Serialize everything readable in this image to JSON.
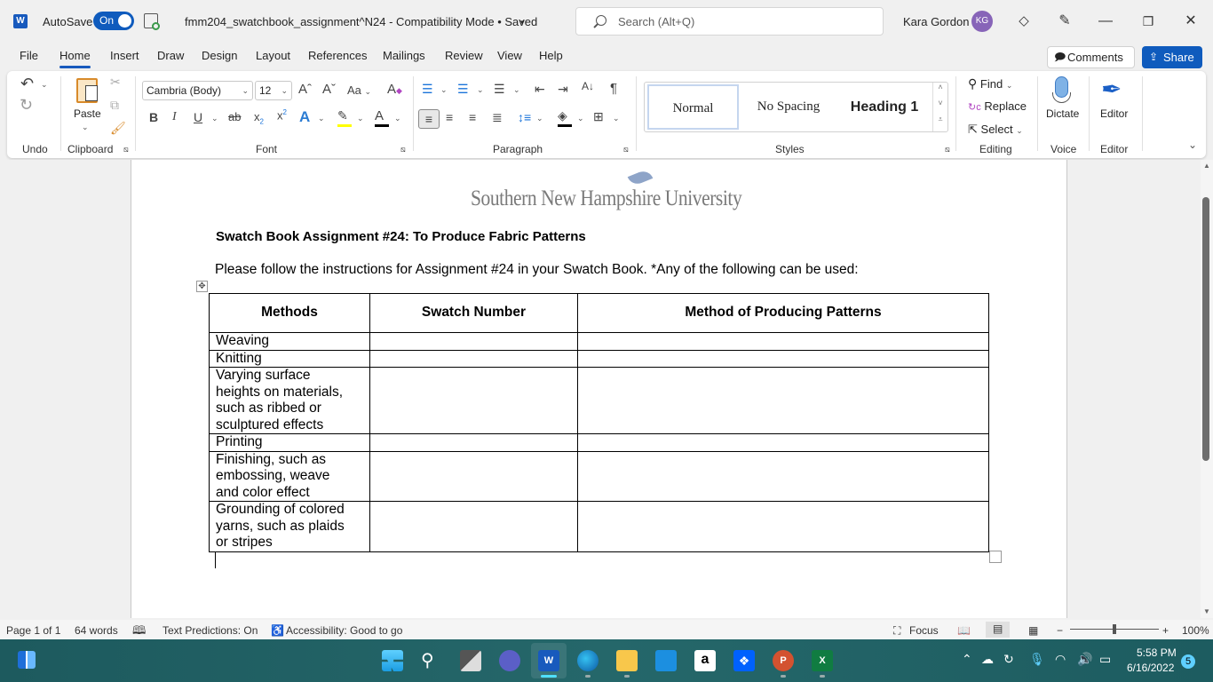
{
  "titlebar": {
    "app_icon": "word-logo-icon",
    "autosave_label": "AutoSave",
    "autosave_state": "On",
    "document_title": "fmm204_swatchbook_assignment^N24  -  Compatibility Mode • Saved",
    "search_placeholder": "Search (Alt+Q)",
    "user_name": "Kara Gordon",
    "user_initials": "KG"
  },
  "menu": {
    "tabs": [
      "File",
      "Home",
      "Insert",
      "Draw",
      "Design",
      "Layout",
      "References",
      "Mailings",
      "Review",
      "View",
      "Help"
    ],
    "active_tab": "Home",
    "comments_label": "Comments",
    "share_label": "Share"
  },
  "ribbon": {
    "groups": [
      "Undo",
      "Clipboard",
      "Font",
      "Paragraph",
      "Styles",
      "Editing",
      "Voice",
      "Editor"
    ],
    "paste_label": "Paste",
    "font_name": "Cambria (Body)",
    "font_size": "12",
    "change_case_label": "Aa",
    "styles": [
      "Normal",
      "No Spacing",
      "Heading 1"
    ],
    "selected_style": "Normal",
    "find_label": "Find",
    "replace_label": "Replace",
    "select_label": "Select",
    "dictate_label": "Dictate",
    "editor_label": "Editor",
    "colors": {
      "highlight": "#ffff00",
      "font_color": "#000000",
      "shading": "#000000"
    }
  },
  "document": {
    "logo_text": "Southern New Hampshire University",
    "title": "Swatch Book Assignment #24: To Produce Fabric Patterns",
    "instructions": "Please follow the instructions for Assignment #24 in your Swatch Book. *Any of the following can be used:",
    "table": {
      "headers": [
        "Methods",
        "Swatch Number",
        "Method of Producing Patterns"
      ],
      "rows": [
        [
          "Weaving",
          "",
          ""
        ],
        [
          "Knitting",
          "",
          ""
        ],
        [
          "Varying surface heights on materials, such as ribbed or sculptured effects",
          "",
          ""
        ],
        [
          "Printing",
          "",
          ""
        ],
        [
          "Finishing, such as embossing, weave and color effect",
          "",
          ""
        ],
        [
          "Grounding of colored yarns, such as plaids or stripes",
          "",
          ""
        ]
      ]
    }
  },
  "statusbar": {
    "page": "Page 1 of 1",
    "words": "64 words",
    "text_predictions": "Text Predictions: On",
    "accessibility": "Accessibility: Good to go",
    "focus_label": "Focus",
    "zoom_percent": "100%",
    "zoom_value": 100
  },
  "taskbar": {
    "apps": [
      "start",
      "search",
      "task-view",
      "teams-chat",
      "word",
      "edge",
      "file-explorer",
      "mail",
      "amazon",
      "dropbox",
      "powerpoint",
      "excel"
    ],
    "active_app": "word",
    "time": "5:58 PM",
    "date": "6/16/2022",
    "notification_count": "5"
  }
}
